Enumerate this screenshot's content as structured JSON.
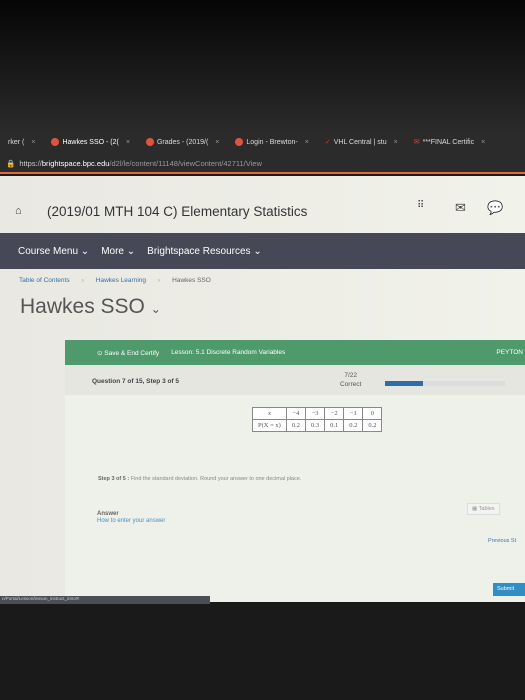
{
  "browser": {
    "tabs": [
      {
        "label": "rker (",
        "icon": "none"
      },
      {
        "label": "Hawkes SSO - (2(",
        "icon": "hawkes-icon"
      },
      {
        "label": "Grades - (2019/(",
        "icon": "hawkes-icon"
      },
      {
        "label": "Login - Brewton-",
        "icon": "hawkes-icon"
      },
      {
        "label": "VHL Central | stu",
        "icon": "vhl-icon"
      },
      {
        "label": "***FINAL Certific",
        "icon": "gmail-icon"
      }
    ],
    "url_prefix": "https://",
    "url_domain": "brightspace.bpc.edu",
    "url_path": "/d2l/le/content/11148/viewContent/42711/View"
  },
  "header": {
    "title": "(2019/01 MTH 104 C) Elementary Statistics"
  },
  "nav": {
    "items": [
      "Course Menu",
      "More",
      "Brightspace Resources"
    ]
  },
  "breadcrumb": [
    "Table of Contents",
    "Hawkes Learning",
    "Hawkes SSO"
  ],
  "page_title": "Hawkes SSO",
  "lesson": {
    "save_label": "Save & End Certify",
    "lesson_label": "Lesson: 5.1 Discrete Random Variables",
    "user": "PEYTON",
    "question": "Question 7 of 15, Step 3 of 5",
    "score": "7/22",
    "score_label": "Correct",
    "progress_fraction": 0.32,
    "progress_color": "#2d6ea8"
  },
  "table": {
    "row1_header": "x",
    "x": [
      "−4",
      "−3",
      "−2",
      "−1",
      "0"
    ],
    "row2_header": "P(X = x)",
    "p": [
      "0.2",
      "0.3",
      "0.1",
      "0.2",
      "0.2"
    ]
  },
  "step": {
    "label": "Step 3 of 5 :",
    "text": "Find the standard deviation. Round your answer to one decimal place."
  },
  "answer": {
    "label": "Answer",
    "help_link": "How to enter your answer",
    "tables_label": "Tables",
    "previous_label": "Previous St",
    "submit_label": "Submit"
  },
  "status_url": "n/Portal/Lesson/lesson_instruct_intro#!"
}
